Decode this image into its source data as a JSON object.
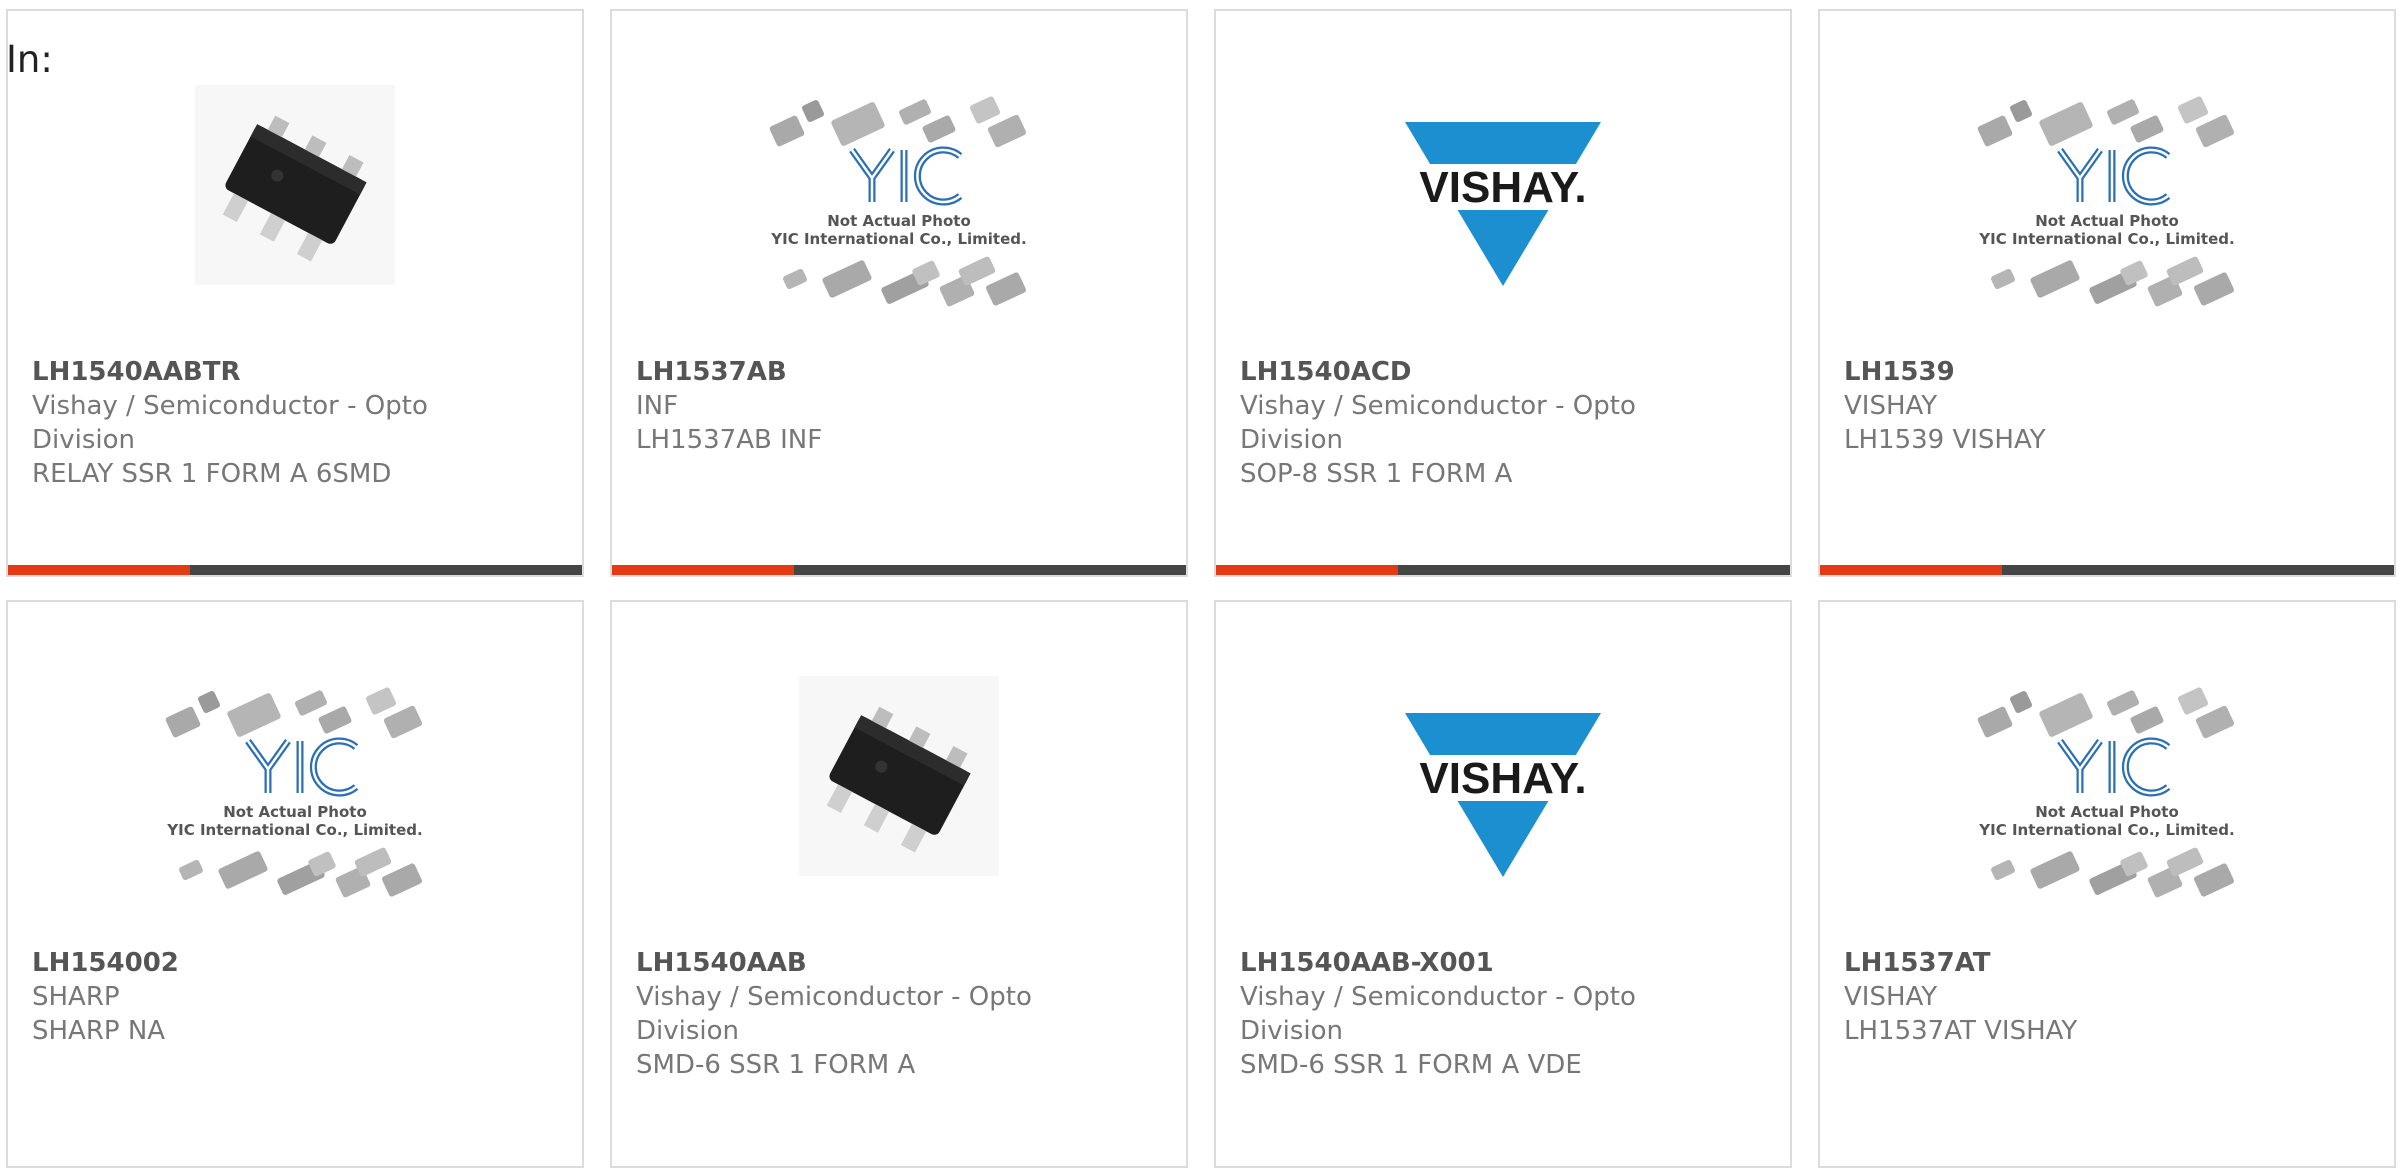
{
  "header": {
    "label": "In:"
  },
  "products": [
    {
      "part": "LH1540AABTR",
      "lines": [
        "Vishay / Semiconductor - Opto",
        "Division",
        "RELAY SSR 1 FORM A 6SMD"
      ],
      "image": "chip-photo-icon"
    },
    {
      "part": "LH1537AB",
      "lines": [
        "INF",
        "LH1537AB INF"
      ],
      "image": "yic-placeholder-icon"
    },
    {
      "part": "LH1540ACD",
      "lines": [
        "Vishay / Semiconductor - Opto",
        "Division",
        "SOP-8 SSR 1 FORM A"
      ],
      "image": "vishay-logo-icon"
    },
    {
      "part": "LH1539",
      "lines": [
        "VISHAY",
        "LH1539 VISHAY"
      ],
      "image": "yic-placeholder-icon"
    },
    {
      "part": "LH154002",
      "lines": [
        "SHARP",
        "SHARP NA"
      ],
      "image": "yic-placeholder-icon"
    },
    {
      "part": "LH1540AAB",
      "lines": [
        "Vishay / Semiconductor - Opto",
        "Division",
        "SMD-6 SSR 1 FORM A"
      ],
      "image": "chip-photo-icon"
    },
    {
      "part": "LH1540AAB-X001",
      "lines": [
        "Vishay / Semiconductor - Opto",
        "Division",
        "SMD-6 SSR 1 FORM A VDE"
      ],
      "image": "vishay-logo-icon"
    },
    {
      "part": "LH1537AT",
      "lines": [
        "VISHAY",
        "LH1537AT VISHAY"
      ],
      "image": "yic-placeholder-icon"
    }
  ],
  "placeholder": {
    "line1": "Not Actual Photo",
    "line2": "YIC International Co., Limited.",
    "logo_text": "YIC"
  },
  "vishay": {
    "text": "VISHAY."
  },
  "colors": {
    "accent": "#e43a14",
    "bar": "#454545",
    "vishay_blue": "#1b8fd0"
  }
}
